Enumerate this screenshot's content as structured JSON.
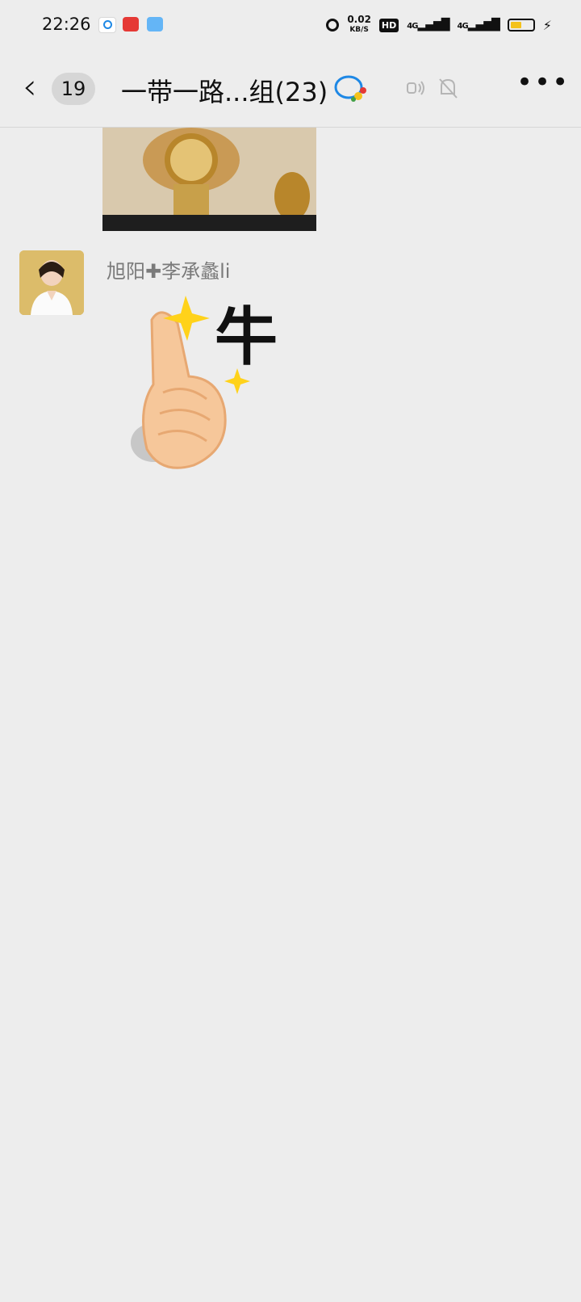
{
  "status_bar": {
    "time": "22:26",
    "net_speed_value": "0.02",
    "net_speed_unit": "KB/S",
    "hd_label": "HD",
    "sig1": "4G",
    "sig2": "4G",
    "battery_level": 0.5,
    "colors": {
      "battery": "#f4c21b"
    }
  },
  "header": {
    "back_icon": "chevron-left-icon",
    "unread_count": "19",
    "title": "一带一路...组(23)"
  },
  "messages": [
    {
      "type": "image",
      "from": "previous",
      "description": "gold-watch-photo"
    },
    {
      "type": "sticker",
      "sender": "旭阳✚李承蠡li",
      "sticker_text": "牛"
    }
  ]
}
